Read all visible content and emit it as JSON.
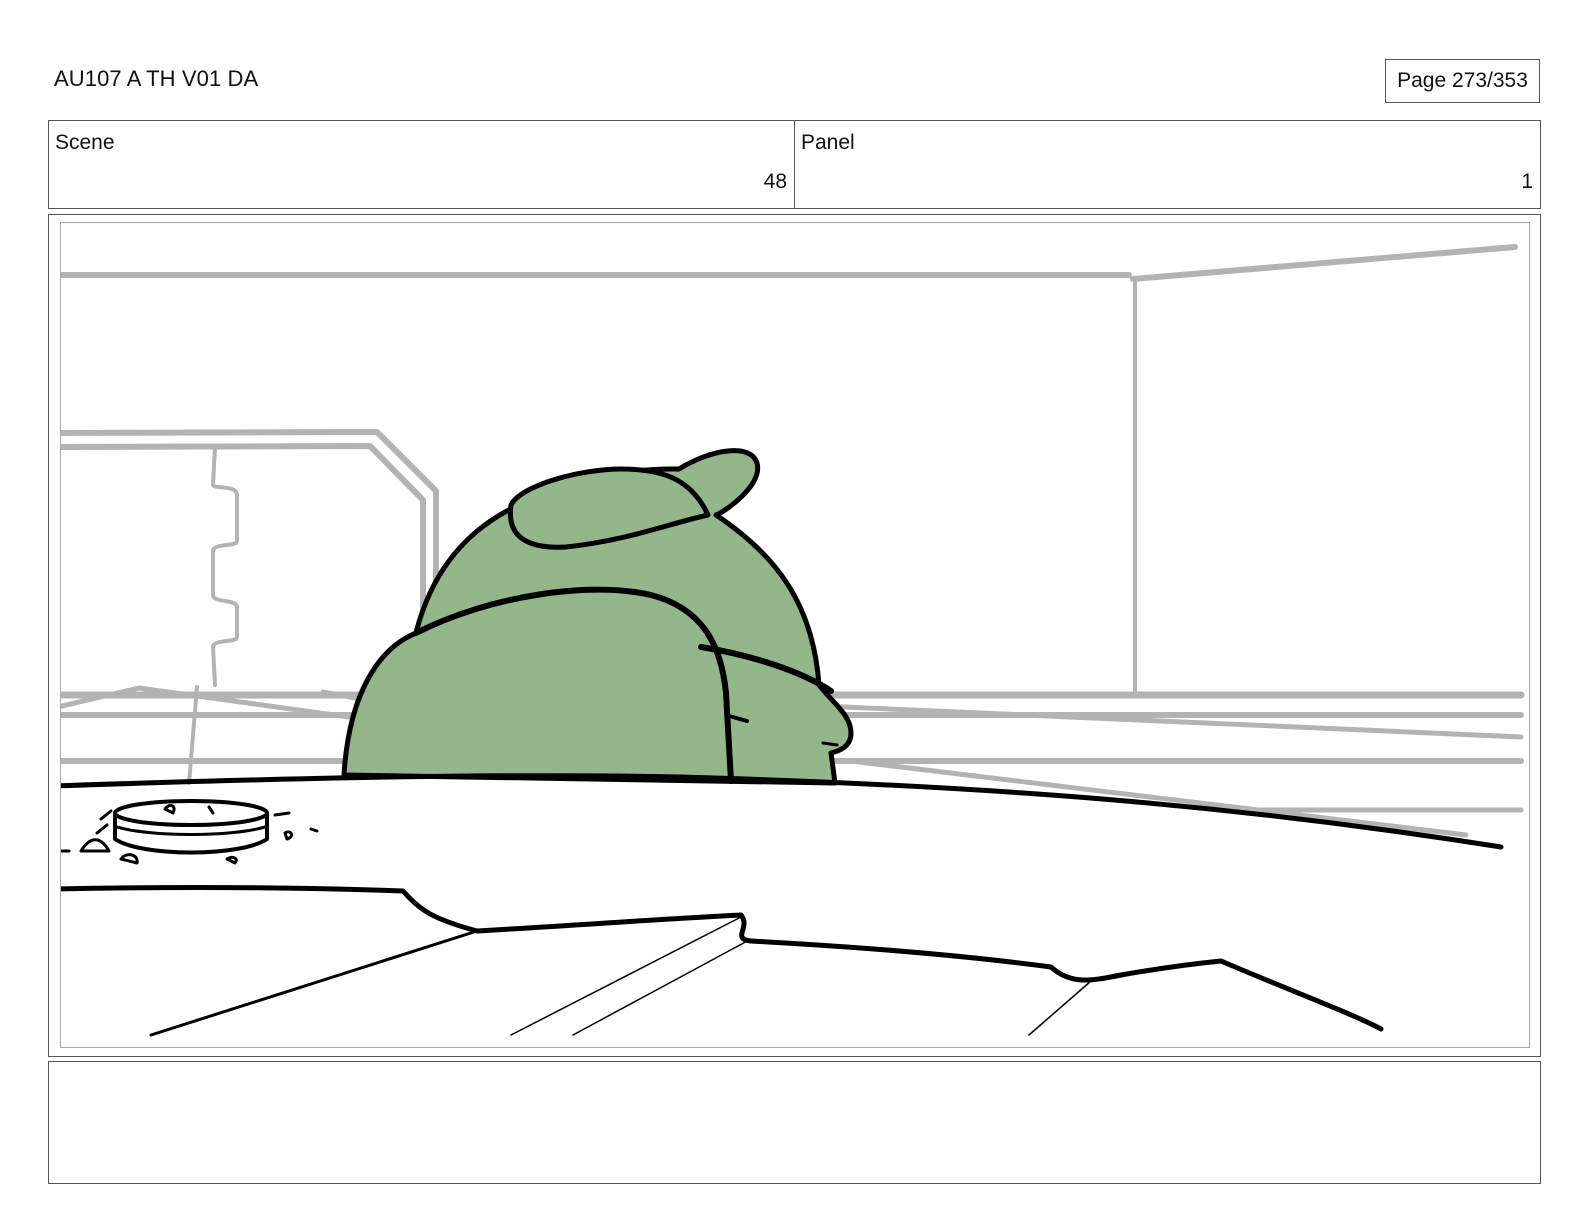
{
  "header": {
    "document_title": "AU107 A TH V01 DA",
    "page_indicator": "Page 273/353"
  },
  "scene": {
    "label": "Scene",
    "value": "48"
  },
  "panel": {
    "label": "Panel",
    "value": "1"
  },
  "artwork": {
    "character_fill": "#93b78a",
    "outline_color": "#000000",
    "background_line_color": "#b3b3b3"
  },
  "notes": {
    "text": ""
  }
}
